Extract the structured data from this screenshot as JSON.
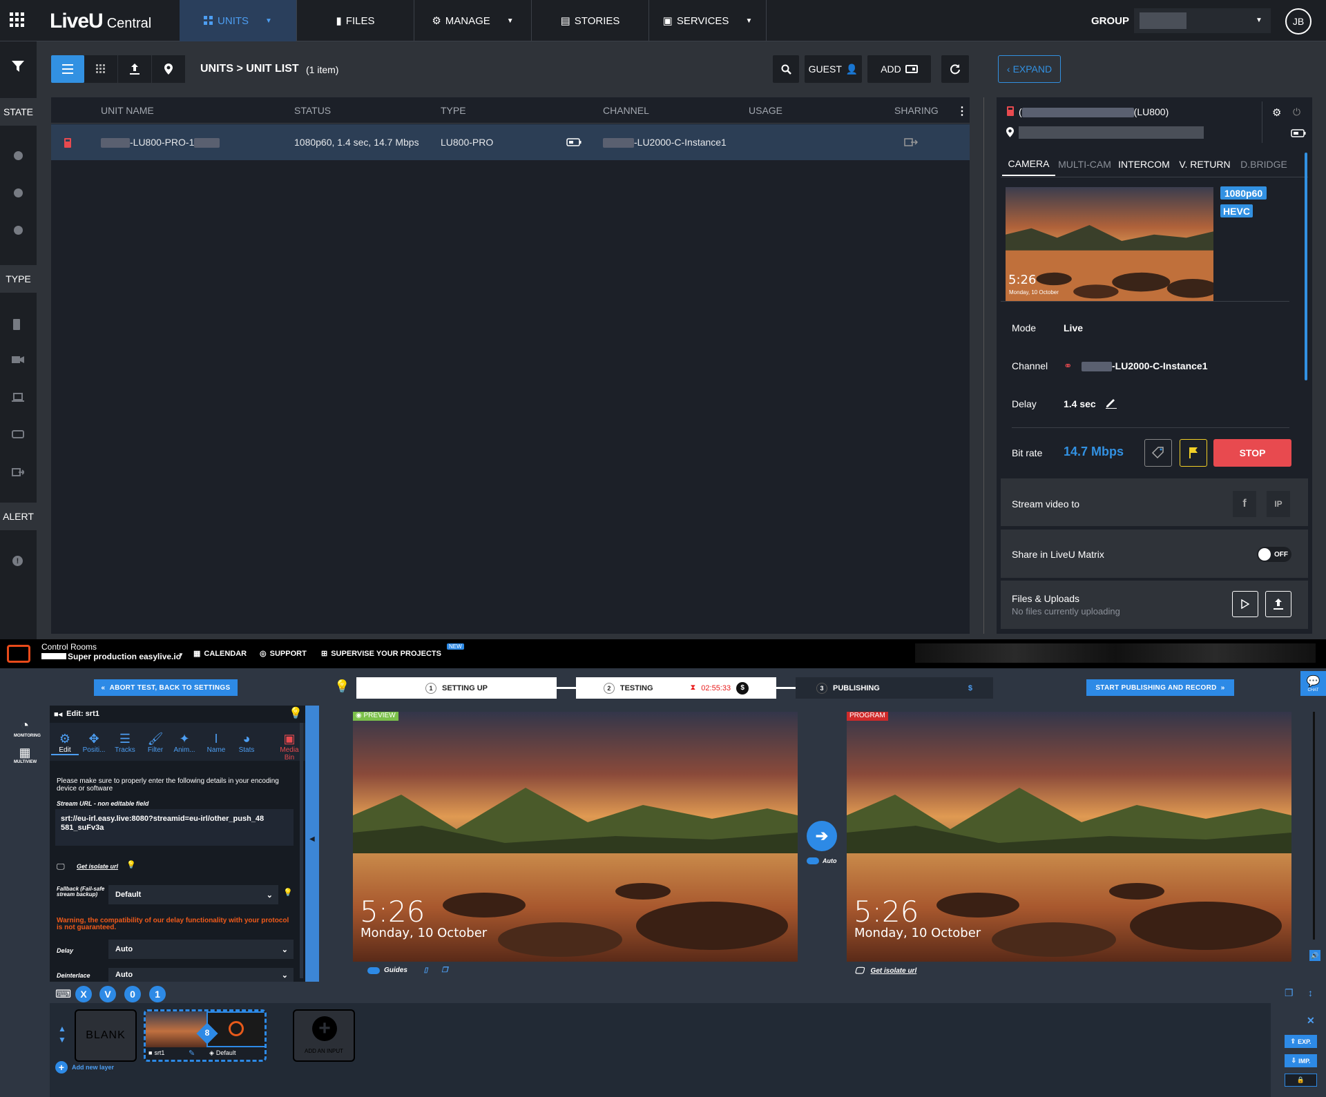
{
  "app": {
    "brand_prefix": "LiveU",
    "brand_suffix": "Central",
    "nav": {
      "units": "UNITS",
      "files": "FILES",
      "manage": "MANAGE",
      "stories": "STORIES",
      "services": "SERVICES",
      "group_label": "GROUP",
      "avatar_initials": "JB"
    },
    "sidebar": {
      "state": "STATE",
      "type": "TYPE",
      "alert": "ALERT"
    },
    "toolbar": {
      "breadcrumb": "UNITS > UNIT LIST",
      "count": "(1 item)",
      "guest": "GUEST",
      "add": "ADD",
      "expand": "EXPAND"
    },
    "table": {
      "columns": {
        "unit_name": "UNIT NAME",
        "status": "STATUS",
        "type": "TYPE",
        "channel": "CHANNEL",
        "usage": "USAGE",
        "sharing": "SHARING"
      },
      "row": {
        "unit_name": "-LU800-PRO-1",
        "status": "1080p60, 1.4 sec, 14.7 Mbps",
        "type": "LU800-PRO",
        "channel": "-LU2000-C-Instance1"
      }
    },
    "panel": {
      "unit_title_prefix": "(",
      "unit_title_suffix": "(LU800)",
      "tabs": [
        "CAMERA",
        "MULTI-CAM",
        "INTERCOM",
        "V. RETURN",
        "D.BRIDGE"
      ],
      "badge_resolution": "1080p60",
      "badge_codec": "HEVC",
      "thumb_time": "5:26",
      "thumb_date": "Monday, 10 October",
      "mode_label": "Mode",
      "mode_value": "Live",
      "channel_label": "Channel",
      "channel_value": "-LU2000-C-Instance1",
      "delay_label": "Delay",
      "delay_value": "1.4 sec",
      "bitrate_label": "Bit rate",
      "bitrate_value": "14.7 Mbps",
      "stop": "STOP",
      "stream_to": "Stream video to",
      "ip": "IP",
      "share_matrix": "Share in LiveU Matrix",
      "toggle_off": "OFF",
      "files_uploads": "Files & Uploads",
      "no_files": "No files currently uploading"
    },
    "colors": {
      "accent": "#3291e2",
      "stop": "#e84a4f",
      "flag": "#f2d027",
      "unit_red": "#e84a4f"
    }
  },
  "control_room": {
    "title": "Control Rooms",
    "production": "Super production easylive.io",
    "calendar": "CALENDAR",
    "support": "SUPPORT",
    "supervise": "SUPERVISE YOUR PROJECTS",
    "new_badge": "NEW",
    "abort": "ABORT TEST, BACK TO SETTINGS",
    "steps": [
      {
        "num": "1",
        "label": "SETTING UP"
      },
      {
        "num": "2",
        "label": "TESTING"
      },
      {
        "num": "3",
        "label": "PUBLISHING"
      }
    ],
    "timer": "02:55:33",
    "start_publish": "START PUBLISHING AND RECORD",
    "chat": "CHAT",
    "monitoring": "MONITORING",
    "multiview": "MULTIVIEW",
    "edit_title": "Edit: srt1",
    "tools": [
      "Edit",
      "Positi...",
      "Tracks",
      "Filter",
      "Anim...",
      "Name",
      "Stats"
    ],
    "media_bin": "Media Bin",
    "info_text": "Please make sure to properly enter the following details in your encoding device or software",
    "stream_url_label": "Stream URL - non editable field",
    "stream_url": "srt://eu-irl.easy.live:8080?streamid=eu-irl/other_push_48581_suFv3a",
    "isolate_link": "Get isolate url",
    "fallback_label": "Fallback (Fail-safe stream backup)",
    "fallback_value": "Default",
    "warning": "Warning, the compatibility of our delay functionality with your protocol is not guaranteed.",
    "delay_label": "Delay",
    "delay_value": "Auto",
    "deinterlace_label": "Deinterlace",
    "deinterlace_value": "Auto",
    "preview_label": "PREVIEW",
    "program_label": "PROGRAM",
    "video_time": "5:26",
    "video_date": "Monday, 10 October",
    "auto": "Auto",
    "guides": "Guides",
    "kbd_keys": [
      "X",
      "V",
      "0",
      "1"
    ],
    "blank": "BLANK",
    "source_name": "srt1",
    "source_default": "Default",
    "layer_num": "8",
    "add_input": "ADD AN INPUT",
    "add_layer": "Add new layer",
    "exp": "EXP.",
    "imp": "IMP."
  }
}
